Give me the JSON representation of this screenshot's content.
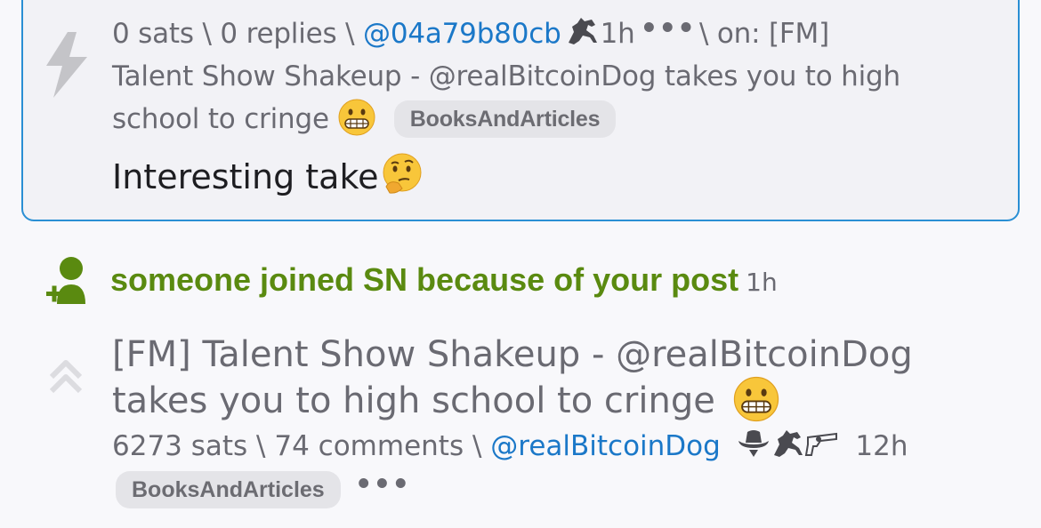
{
  "reply": {
    "sats": "0 sats",
    "sep1": " \\ ",
    "replies": "0 replies",
    "sep2": " \\ ",
    "author": "@04a79b80cb",
    "time": "1h",
    "more": "•••",
    "on_prefix": "\\ on: [FM]",
    "parent_title_line2": "Talent Show Shakeup - @realBitcoinDog takes you to high",
    "parent_title_line3": "school to cringe",
    "tag": "BooksAndArticles",
    "body": "Interesting take"
  },
  "referral": {
    "text": "someone joined SN because of your post",
    "time": "1h"
  },
  "item": {
    "title_line1": "[FM] Talent Show Shakeup - @realBitcoinDog",
    "title_line2": "takes you to high school to cringe",
    "sats": "6273 sats",
    "sep1": " \\ ",
    "comments": "74 comments",
    "sep2": " \\ ",
    "author": "@realBitcoinDog",
    "time": "12h",
    "tag": "BooksAndArticles",
    "more": "•••"
  },
  "colors": {
    "accent_link": "#1b78c8",
    "card_border": "#2a8fd4",
    "referral_green": "#5a8a10",
    "muted_text": "#6a6a72"
  },
  "icons": {
    "zap": "lightning-bolt-icon",
    "horse": "horse-icon",
    "cowboy": "cowboy-hat-icon",
    "gun": "revolver-icon",
    "user_add": "user-add-icon",
    "upvote": "double-chevron-up-icon",
    "grimace": "grimacing-face-emoji",
    "thinking": "thinking-face-emoji"
  }
}
